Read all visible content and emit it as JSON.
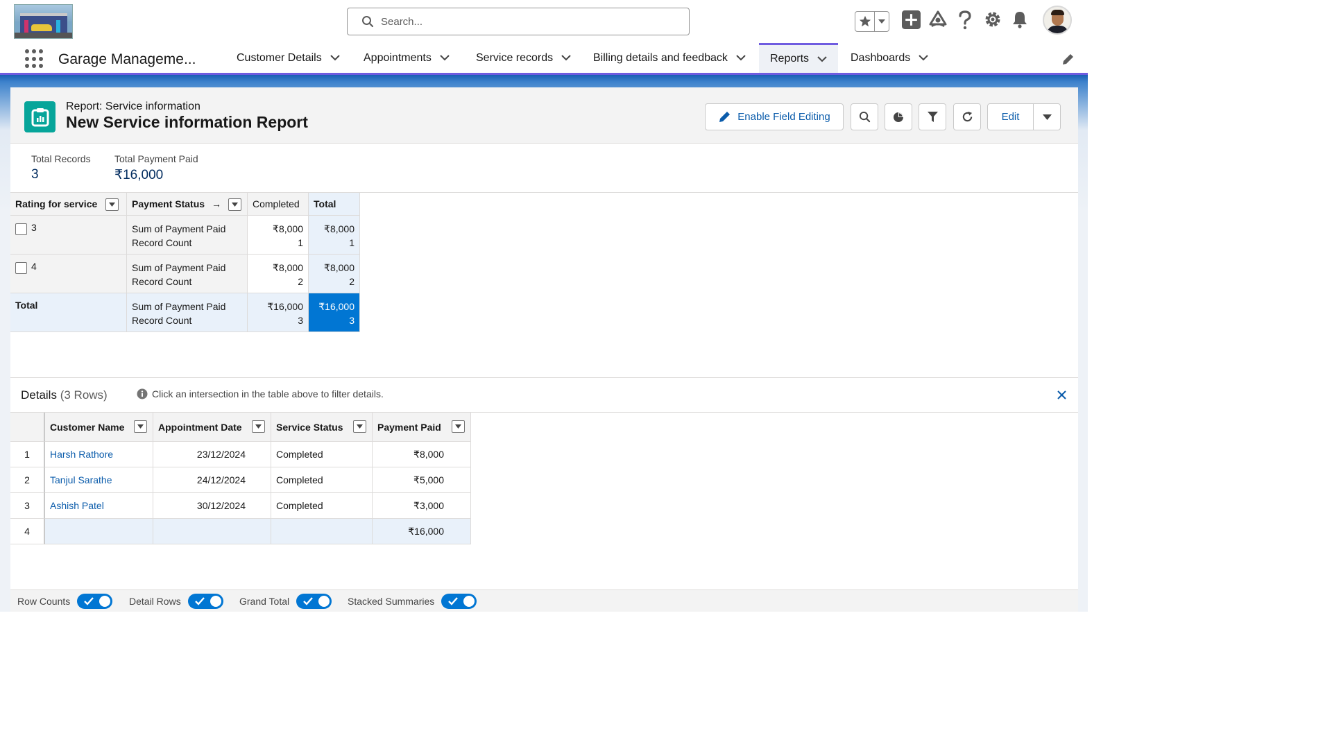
{
  "search": {
    "placeholder": "Search..."
  },
  "nav": {
    "app_name": "Garage Manageme...",
    "tabs": [
      {
        "label": "Customer Details"
      },
      {
        "label": "Appointments"
      },
      {
        "label": "Service records"
      },
      {
        "label": "Billing details and feedback"
      },
      {
        "label": "Reports",
        "active": true
      },
      {
        "label": "Dashboards"
      }
    ]
  },
  "header_icons": [
    "star-icon",
    "add-icon",
    "trailhead-icon",
    "help-icon",
    "setup-gear-icon",
    "notification-bell-icon"
  ],
  "report": {
    "type_label": "Report: Service information",
    "title": "New Service information Report",
    "enable_editing_label": "Enable Field Editing",
    "edit_label": "Edit"
  },
  "stats": {
    "total_records_label": "Total Records",
    "total_records_value": "3",
    "total_payment_label": "Total Payment Paid",
    "total_payment_value": "₹16,000"
  },
  "matrix": {
    "row_group_header": "Rating for service",
    "col_group_header": "Payment Status",
    "col_values": [
      "Completed",
      "Total"
    ],
    "measure_sum": "Sum of Payment Paid",
    "measure_count": "Record Count",
    "rows": [
      {
        "label": "3",
        "completed_sum": "₹8,000",
        "completed_count": "1",
        "total_sum": "₹8,000",
        "total_count": "1"
      },
      {
        "label": "4",
        "completed_sum": "₹8,000",
        "completed_count": "2",
        "total_sum": "₹8,000",
        "total_count": "2"
      }
    ],
    "total": {
      "label": "Total",
      "completed_sum": "₹16,000",
      "completed_count": "3",
      "total_sum": "₹16,000",
      "total_count": "3"
    }
  },
  "details": {
    "title": "Details",
    "row_count": "(3 Rows)",
    "hint": "Click an intersection in the table above to filter details.",
    "columns": [
      "Customer Name",
      "Appointment Date",
      "Service Status",
      "Payment Paid"
    ],
    "rows": [
      {
        "num": "1",
        "customer": "Harsh Rathore",
        "date": "23/12/2024",
        "status": "Completed",
        "payment": "₹8,000"
      },
      {
        "num": "2",
        "customer": "Tanjul Sarathe",
        "date": "24/12/2024",
        "status": "Completed",
        "payment": "₹5,000"
      },
      {
        "num": "3",
        "customer": "Ashish Patel",
        "date": "30/12/2024",
        "status": "Completed",
        "payment": "₹3,000"
      }
    ],
    "summary": {
      "num": "4",
      "payment": "₹16,000"
    }
  },
  "toggles": [
    {
      "label": "Row Counts",
      "on": true
    },
    {
      "label": "Detail Rows",
      "on": true
    },
    {
      "label": "Grand Total",
      "on": true
    },
    {
      "label": "Stacked Summaries",
      "on": true
    }
  ],
  "colors": {
    "brand": "#0176d3",
    "nav_accent": "#6f5ce0",
    "report_icon": "#06a59a",
    "link": "#0b5cab"
  }
}
